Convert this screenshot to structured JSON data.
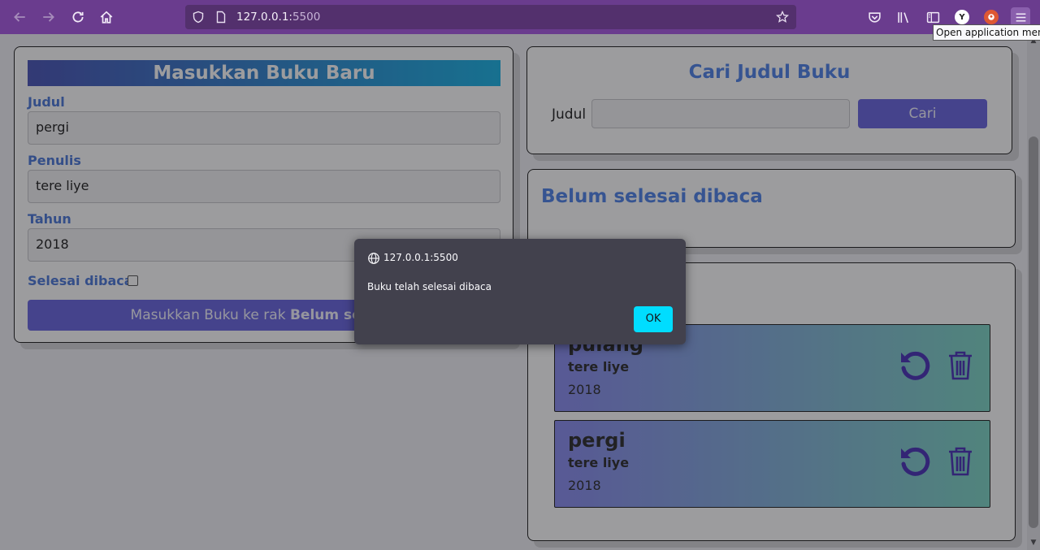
{
  "browser": {
    "url_host": "127.0.0.1:",
    "url_port": "5500",
    "tooltip": "Open application menu"
  },
  "form": {
    "title": "Masukkan Buku Baru",
    "judul_label": "Judul",
    "judul_value": "pergi",
    "penulis_label": "Penulis",
    "penulis_value": "tere liye",
    "tahun_label": "Tahun",
    "tahun_value": "2018",
    "selesai_label": "Selesai dibaca",
    "submit_prefix": "Masukkan Buku ke rak ",
    "submit_bold": "Belum selesai"
  },
  "search": {
    "title": "Cari Judul Buku",
    "label": "Judul",
    "button": "Cari"
  },
  "unfinished": {
    "title": "Belum selesai dibaca"
  },
  "finished": {
    "books": [
      {
        "title": "pulang",
        "author": "tere liye",
        "year": "2018"
      },
      {
        "title": "pergi",
        "author": "tere liye",
        "year": "2018"
      }
    ]
  },
  "dialog": {
    "origin": "127.0.0.1:5500",
    "message": "Buku telah selesai dibaca",
    "ok": "OK"
  },
  "colors": {
    "toolbar": "#6a3c8e",
    "accent_blue": "#5083e8",
    "button": "#6a66e0",
    "dialog_bg": "#42414d",
    "ok_button": "#00ddff"
  }
}
